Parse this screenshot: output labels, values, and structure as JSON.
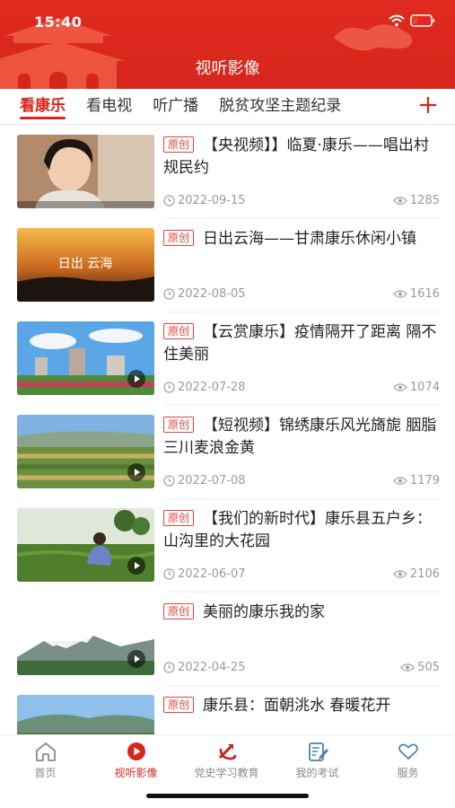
{
  "status_bar": {
    "time": "15:40"
  },
  "header": {
    "title": "视听影像"
  },
  "tabs": [
    {
      "label": "看康乐",
      "active": true
    },
    {
      "label": "看电视",
      "active": false
    },
    {
      "label": "听广播",
      "active": false
    },
    {
      "label": "脱贫攻坚主题纪录",
      "active": false
    }
  ],
  "colors": {
    "brand": "#d8261c",
    "badge": "#e0443a"
  },
  "items": [
    {
      "badge": "原创",
      "title": "【央视频】】临夏·康乐——唱出村规民约",
      "date": "2022-09-15",
      "views": "1285",
      "thumb_text": ""
    },
    {
      "badge": "原创",
      "title": "日出云海——甘肃康乐休闲小镇",
      "date": "2022-08-05",
      "views": "1616",
      "thumb_text": "日出 云海"
    },
    {
      "badge": "原创",
      "title": "【云赏康乐】疫情隔开了距离 隔不住美丽",
      "date": "2022-07-28",
      "views": "1074",
      "thumb_text": ""
    },
    {
      "badge": "原创",
      "title": "【短视频】锦绣康乐风光旖旎 胭脂三川麦浪金黄",
      "date": "2022-07-08",
      "views": "1179",
      "thumb_text": ""
    },
    {
      "badge": "原创",
      "title": "【我们的新时代】康乐县五户乡：山沟里的大花园",
      "date": "2022-06-07",
      "views": "2106",
      "thumb_text": ""
    },
    {
      "badge": "原创",
      "title": "美丽的康乐我的家",
      "date": "2022-04-25",
      "views": "505",
      "thumb_text": ""
    },
    {
      "badge": "原创",
      "title": "康乐县：面朝洮水 春暖花开",
      "date": "",
      "views": "",
      "thumb_text": ""
    }
  ],
  "bottom_nav": [
    {
      "label": "首页",
      "icon": "home-icon",
      "active": false
    },
    {
      "label": "视听影像",
      "icon": "play-circle-icon",
      "active": true
    },
    {
      "label": "党史学习教育",
      "icon": "party-emblem-icon",
      "active": false
    },
    {
      "label": "我的考试",
      "icon": "exam-edit-icon",
      "active": false
    },
    {
      "label": "服务",
      "icon": "heart-icon",
      "active": false
    }
  ]
}
